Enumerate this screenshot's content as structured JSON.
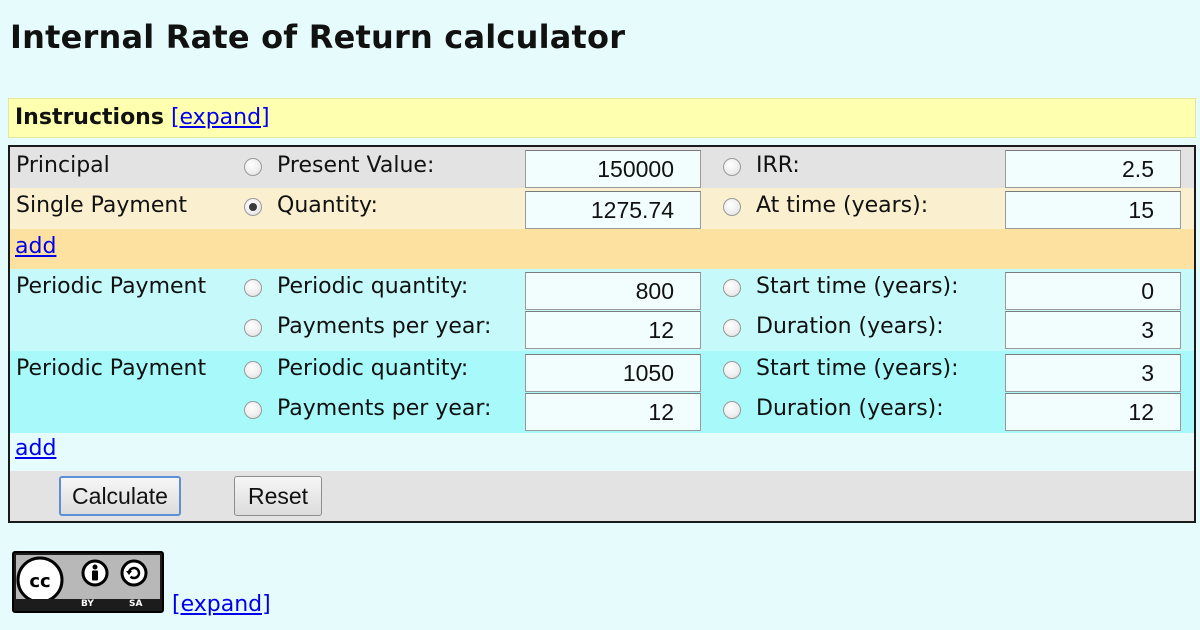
{
  "page": {
    "title": "Internal Rate of Return calculator"
  },
  "instructions": {
    "label": "Instructions",
    "expand_link": "[expand]"
  },
  "principal": {
    "label": "Principal",
    "present_value_label": "Present Value:",
    "present_value": "150000",
    "irr_label": "IRR:",
    "irr": "2.5",
    "selected": "none"
  },
  "single_payment": {
    "label": "Single Payment",
    "quantity_label": "Quantity:",
    "quantity": "1275.74",
    "time_label": "At time (years):",
    "time": "15",
    "selected": "quantity"
  },
  "add_link_1": "add",
  "periodic_payments": [
    {
      "label": "Periodic Payment",
      "quantity_label": "Periodic quantity:",
      "quantity": "800",
      "start_label": "Start time (years):",
      "start": "0",
      "ppy_label": "Payments per year:",
      "ppy": "12",
      "duration_label": "Duration (years):",
      "duration": "3"
    },
    {
      "label": "Periodic Payment",
      "quantity_label": "Periodic quantity:",
      "quantity": "1050",
      "start_label": "Start time (years):",
      "start": "3",
      "ppy_label": "Payments per year:",
      "ppy": "12",
      "duration_label": "Duration (years):",
      "duration": "12"
    }
  ],
  "add_link_2": "add",
  "buttons": {
    "calculate": "Calculate",
    "reset": "Reset"
  },
  "license": {
    "cc_text": "cc",
    "by_text": "BY",
    "sa_text": "SA",
    "expand_link": "[expand]"
  },
  "colors": {
    "background": "#e6fbfb",
    "instructions_bg": "#ffffb0",
    "principal_row_bg": "#e3e3e3",
    "single_row_bg": "#faf0d0",
    "add_row_bg": "#fde1a0",
    "periodic_1_bg": "#c6fafa",
    "periodic_2_bg": "#a8fafa",
    "link": "#0000ee"
  },
  "icons": {
    "cc": "creative-commons-icon",
    "by": "attribution-person-icon",
    "sa": "share-alike-icon"
  }
}
